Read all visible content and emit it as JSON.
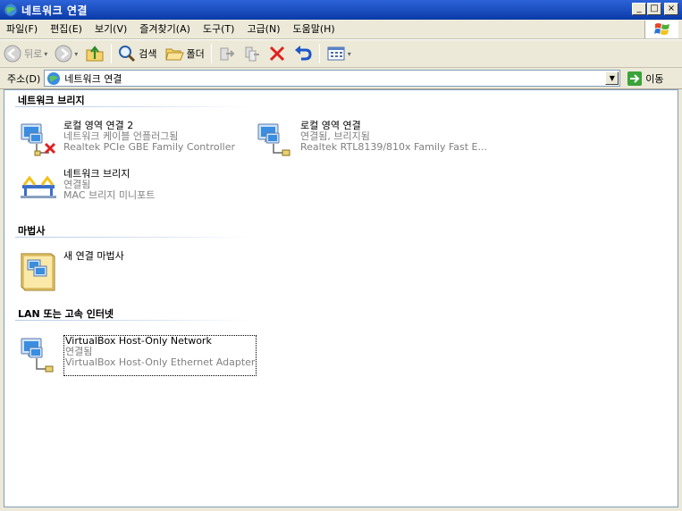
{
  "window": {
    "title": "네트워크 연결",
    "minimize": "_",
    "maximize": "□",
    "close": "×"
  },
  "menu": [
    "파일(F)",
    "편집(E)",
    "보기(V)",
    "즐겨찾기(A)",
    "도구(T)",
    "고급(N)",
    "도움말(H)"
  ],
  "toolbar": {
    "back_label": "뒤로",
    "search_label": "검색",
    "folders_label": "폴더"
  },
  "address": {
    "label": "주소(D)",
    "value": "네트워크 연결",
    "go_label": "이동"
  },
  "groups": [
    {
      "header": "네트워크 브리지",
      "items": [
        {
          "name": "로컬 영역 연결 2",
          "status": "네트워크 케이블 언플러그됨",
          "device": "Realtek PCIe GBE Family Controller"
        },
        {
          "name": "로컬 영역 연결",
          "status": "연결됨, 브리지됨",
          "device": "Realtek RTL8139/810x Family Fast E..."
        },
        {
          "name": "네트워크 브리지",
          "status": "연결됨",
          "device": "MAC 브리지 미니포트"
        }
      ]
    },
    {
      "header": "마법사",
      "items": [
        {
          "name": "새 연결 마법사"
        }
      ]
    },
    {
      "header": "LAN 또는 고속 인터넷",
      "items": [
        {
          "name": "VirtualBox Host-Only Network",
          "status": "연결됨",
          "device": "VirtualBox Host-Only Ethernet Adapter"
        }
      ]
    }
  ],
  "colors": {
    "titlebar": "#0a3aa8",
    "chrome": "#ece9d8",
    "group_line": "#b7c8e3",
    "disconnect_x": "#e02020"
  }
}
